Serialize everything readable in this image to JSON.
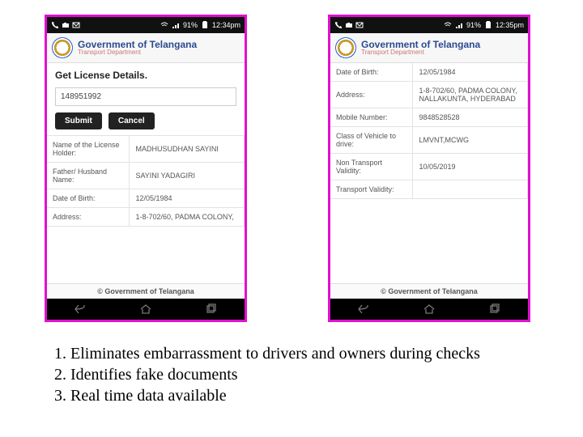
{
  "statusbar": {
    "signal_pct": "91%",
    "time_left": "12:34pm",
    "time_right": "12:35pm"
  },
  "header": {
    "gov_line": "Government of Telangana",
    "dept_line": "Transport Department"
  },
  "left_phone": {
    "title": "Get License Details.",
    "input_value": "148951992",
    "btn_submit": "Submit",
    "btn_cancel": "Cancel",
    "rows": [
      {
        "label": "Name of the License Holder:",
        "value": "MADHUSUDHAN SAYINI"
      },
      {
        "label": "Father/ Husband Name:",
        "value": "SAYINI YADAGIRI"
      },
      {
        "label": "Date of Birth:",
        "value": "12/05/1984"
      },
      {
        "label": "Address:",
        "value": "1-8-702/60, PADMA COLONY,"
      }
    ]
  },
  "right_phone": {
    "rows": [
      {
        "label": "Date of Birth:",
        "value": "12/05/1984"
      },
      {
        "label": "Address:",
        "value": "1-8-702/60, PADMA COLONY, NALLAKUNTA, HYDERABAD"
      },
      {
        "label": "Mobile Number:",
        "value": "9848528528"
      },
      {
        "label": "Class of Vehicle to drive:",
        "value": "LMVNT,MCWG"
      },
      {
        "label": "Non Transport Validity:",
        "value": "10/05/2019"
      },
      {
        "label": "Transport Validity:",
        "value": ""
      }
    ]
  },
  "footer": "© Government of Telangana",
  "bullets": [
    "Eliminates embarrassment to drivers and owners during checks",
    "Identifies fake documents",
    "Real time data available"
  ]
}
